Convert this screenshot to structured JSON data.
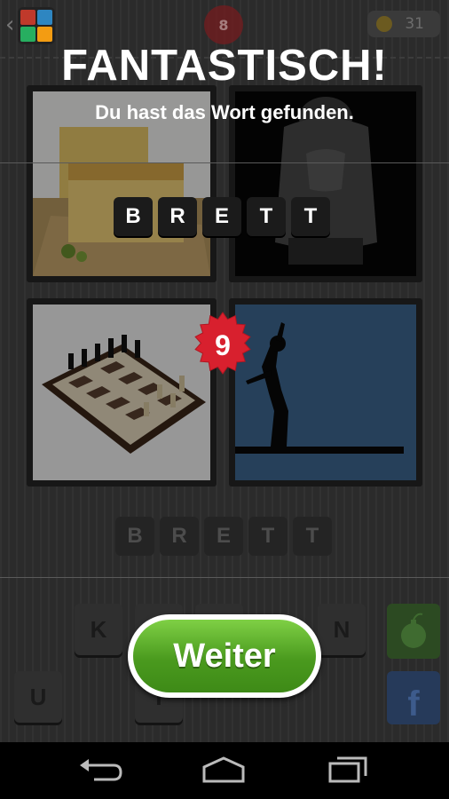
{
  "header": {
    "level": "8",
    "coins": "31"
  },
  "overlay": {
    "title": "FANTASTISCH!",
    "subtitle": "Du hast das Wort gefunden."
  },
  "solved_word": [
    "B",
    "R",
    "E",
    "T",
    "T"
  ],
  "answer_slots": [
    "B",
    "R",
    "E",
    "T",
    "T"
  ],
  "next_level_badge": "9",
  "letter_keys": [
    "K",
    "",
    "",
    "N",
    "U",
    "T"
  ],
  "continue_button": "Weiter",
  "facebook_label": "f",
  "pictures": [
    "cake-on-cutting-board",
    "shirtless-man-torso",
    "chess-board",
    "silhouette-figure-on-beam"
  ],
  "colors": {
    "continue_green": "#5cb02a",
    "badge_red": "#d8202e",
    "background": "#2b2b2b"
  }
}
